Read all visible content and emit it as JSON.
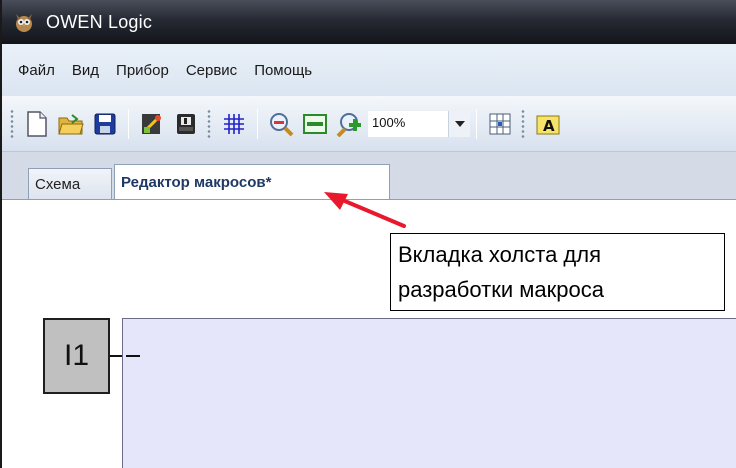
{
  "window": {
    "title": "OWEN Logic",
    "icon": "owl-app-icon"
  },
  "menu": {
    "items": [
      "Файл",
      "Вид",
      "Прибор",
      "Сервис",
      "Помощь"
    ]
  },
  "toolbar": {
    "zoom_value": "100%",
    "buttons": [
      "new-file-icon",
      "open-folder-icon",
      "save-icon",
      "macro-wizard-icon",
      "device-icon",
      "grid-icon",
      "zoom-out-icon",
      "fit-page-icon",
      "zoom-in-icon",
      "layout-grid-icon",
      "text-icon"
    ]
  },
  "tabs": [
    {
      "label": "Схема",
      "active": false
    },
    {
      "label": "Редактор макросов*",
      "active": true
    }
  ],
  "canvas": {
    "input_block_label": "I1"
  },
  "annotation": {
    "line1": "Вкладка холста для",
    "line2": "разработки макроса",
    "arrow_color": "#e8192c"
  }
}
